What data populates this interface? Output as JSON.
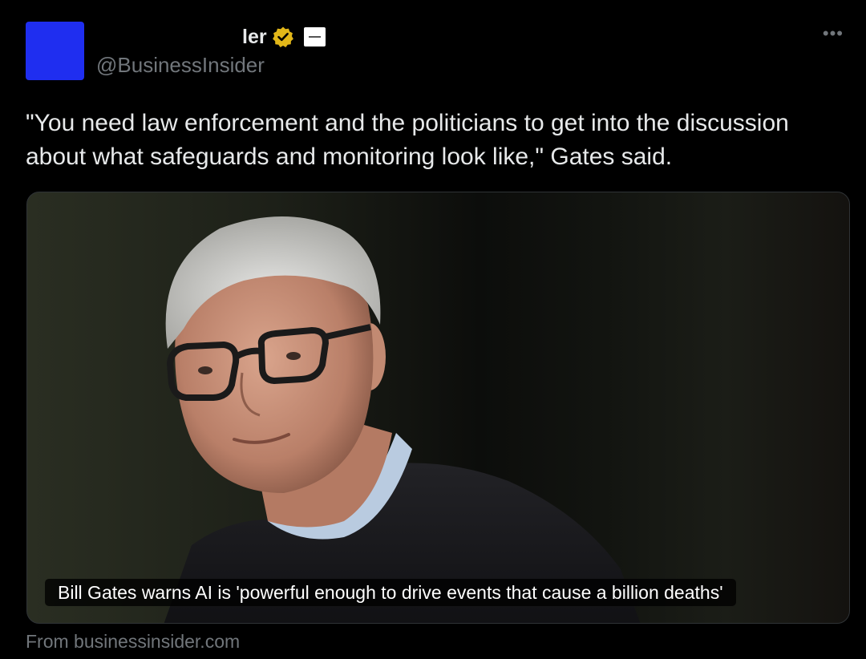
{
  "author": {
    "display_name_visible": "ler",
    "handle": "@BusinessInsider",
    "avatar_color": "#1f2ef0",
    "verified_badge_color": "#e2b719"
  },
  "actions": {
    "more_label": "•••"
  },
  "post": {
    "text": "\"You need law enforcement and the politicians to get into the discussion about what safeguards and monitoring look like,\" Gates said."
  },
  "card": {
    "headline": "Bill Gates warns AI is 'powerful enough to drive events that cause a billion deaths'",
    "source": "From businessinsider.com"
  },
  "icons": {
    "verified": "verified-check-icon",
    "affiliate": "affiliate-badge-icon",
    "more": "more-options-icon"
  }
}
